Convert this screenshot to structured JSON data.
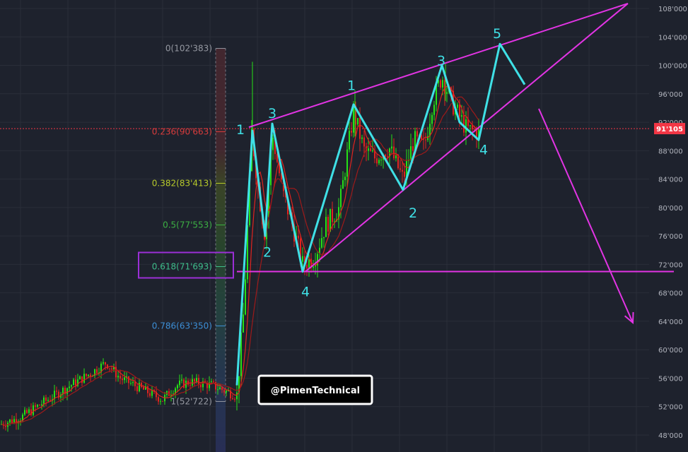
{
  "chart_data": {
    "type": "candlestick",
    "y_axis": {
      "ylim": [
        46000,
        109500
      ],
      "tick_values": [
        48000,
        52000,
        56000,
        60000,
        64000,
        68000,
        72000,
        76000,
        80000,
        84000,
        88000,
        92000,
        96000,
        100000,
        104000,
        108000
      ],
      "tick_labels": [
        "48'000",
        "52'000",
        "56'000",
        "60'000",
        "64'000",
        "68'000",
        "72'000",
        "76'000",
        "80'000",
        "84'000",
        "88'000",
        "92'000",
        "96'000",
        "100'000",
        "104'000",
        "108'000"
      ],
      "grid": true
    },
    "current_price": {
      "value": 91105,
      "label": "91'105",
      "color": "#f23645"
    },
    "fibonacci": [
      {
        "ratio": "0",
        "price": 102383,
        "label": "0(102'383)",
        "color": "#9598a1"
      },
      {
        "ratio": "0.236",
        "price": 90663,
        "label": "0.236(90'663)",
        "color": "#d83c3c"
      },
      {
        "ratio": "0.382",
        "price": 83413,
        "label": "0.382(83'413)",
        "color": "#b6c92a"
      },
      {
        "ratio": "0.5",
        "price": 77553,
        "label": "0.5(77'553)",
        "color": "#3cb043"
      },
      {
        "ratio": "0.618",
        "price": 71693,
        "label": "0.618(71'693)",
        "color": "#3dbd8a"
      },
      {
        "ratio": "0.786",
        "price": 63350,
        "label": "0.786(63'350)",
        "color": "#3d8fd6"
      },
      {
        "ratio": "1",
        "price": 52722,
        "label": "1(52'722)",
        "color": "#9598a1"
      }
    ],
    "wave_labels": [
      {
        "text": "1",
        "x": 340,
        "price": 91000
      },
      {
        "text": "3",
        "x": 385,
        "price": 93300
      },
      {
        "text": "2",
        "x": 378,
        "price": 73800
      },
      {
        "text": "4",
        "x": 432,
        "price": 68200
      },
      {
        "text": "1",
        "x": 497,
        "price": 97200
      },
      {
        "text": "2",
        "x": 584,
        "price": 79300
      },
      {
        "text": "3",
        "x": 624,
        "price": 100700
      },
      {
        "text": "4",
        "x": 684,
        "price": 88200
      },
      {
        "text": "5",
        "x": 703,
        "price": 104500
      }
    ],
    "wave_path": [
      [
        335,
        55000
      ],
      [
        357,
        90800
      ],
      [
        375,
        76000
      ],
      [
        385,
        91800
      ],
      [
        428,
        71000
      ],
      [
        500,
        94500
      ],
      [
        570,
        82500
      ],
      [
        625,
        100000
      ],
      [
        650,
        92000
      ],
      [
        677,
        89500
      ],
      [
        707,
        103000
      ],
      [
        742,
        97300
      ]
    ],
    "wedge_upper": [
      [
        352,
        91300
      ],
      [
        888,
        108700
      ]
    ],
    "wedge_lower": [
      [
        432,
        71000
      ],
      [
        888,
        108700
      ]
    ],
    "support_line": {
      "price": 71000,
      "x_start": 335,
      "x_end": 953,
      "color": "#e234e4"
    },
    "projection_arrow": [
      [
        762,
        93900
      ],
      [
        895,
        63800
      ]
    ],
    "highlight_box_target": "0.618",
    "watermark": "@PimenTechnical"
  }
}
